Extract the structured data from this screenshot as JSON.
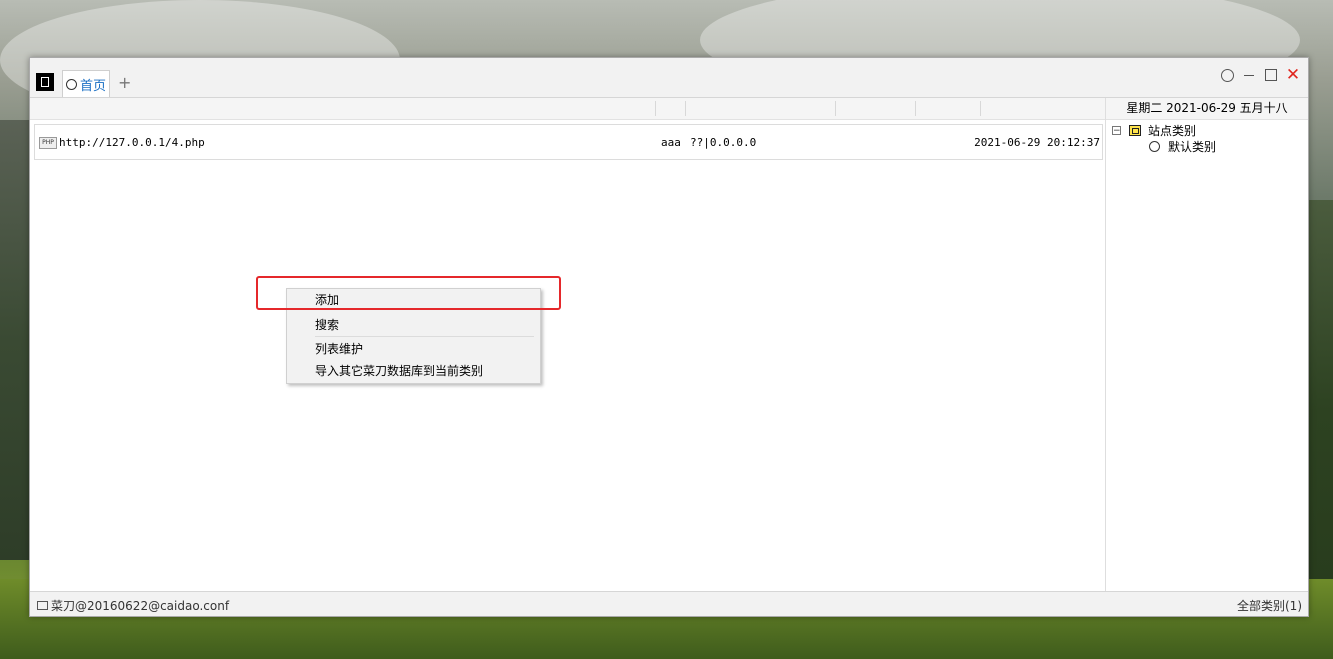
{
  "tab": {
    "label": "首页"
  },
  "header": {
    "date_text": "星期二 2021-06-29 五月十八"
  },
  "entries": [
    {
      "url": "http://127.0.0.1/4.php",
      "note": "aaa",
      "ip": "??|0.0.0.0",
      "time": "2021-06-29 20:12:37"
    }
  ],
  "tree": {
    "root_label": "站点类别",
    "child_label": "默认类别"
  },
  "status": {
    "left": "菜刀@20160622@caidao.conf",
    "right": "全部类别(1)"
  },
  "context_menu": {
    "items": [
      "添加",
      "搜索",
      "列表维护",
      "导入其它菜刀数据库到当前类别"
    ]
  },
  "colors": {
    "accent": "#1a6fc4",
    "close": "#e0261f",
    "highlight_box": "#e5282b"
  }
}
